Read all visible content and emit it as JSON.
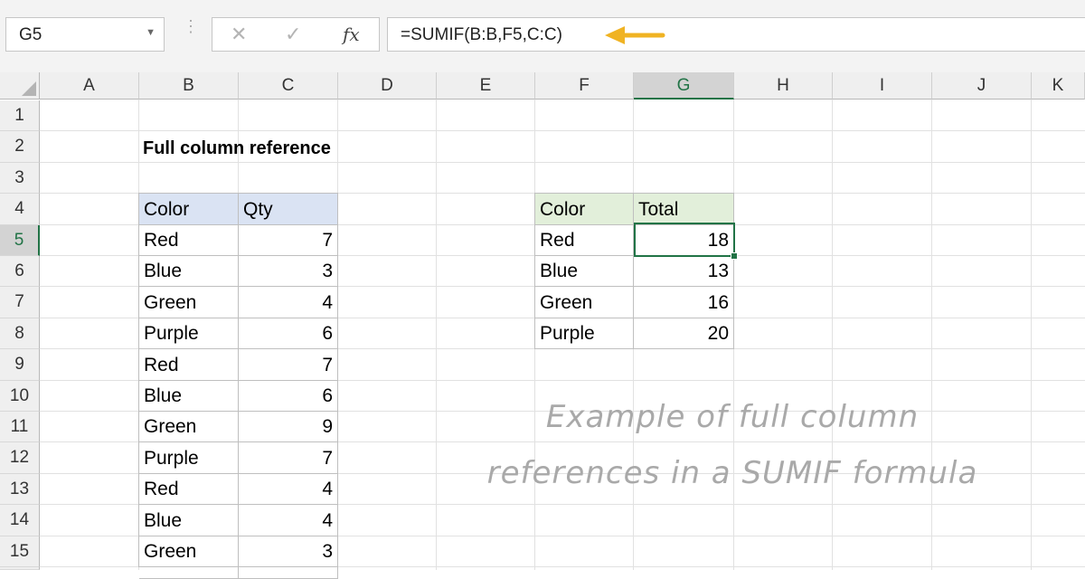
{
  "formula_bar": {
    "name_box": "G5",
    "formula": "=SUMIF(B:B,F5,C:C)",
    "cancel_icon": "x-icon",
    "enter_icon": "check-icon",
    "fx_label": "fx",
    "arrow_color": "#f0b323"
  },
  "columns": [
    "A",
    "B",
    "C",
    "D",
    "E",
    "F",
    "G",
    "H",
    "I",
    "J",
    "K"
  ],
  "selected_column": "G",
  "rows": [
    "1",
    "2",
    "3",
    "4",
    "5",
    "6",
    "7",
    "8",
    "9",
    "10",
    "11",
    "12",
    "13",
    "14",
    "15"
  ],
  "selected_row": "5",
  "sheet_title": "Full column reference",
  "data_table": {
    "headers": [
      "Color",
      "Qty"
    ],
    "rows": [
      [
        "Red",
        "7"
      ],
      [
        "Blue",
        "3"
      ],
      [
        "Green",
        "4"
      ],
      [
        "Purple",
        "6"
      ],
      [
        "Red",
        "7"
      ],
      [
        "Blue",
        "6"
      ],
      [
        "Green",
        "9"
      ],
      [
        "Purple",
        "7"
      ],
      [
        "Red",
        "4"
      ],
      [
        "Blue",
        "4"
      ],
      [
        "Green",
        "3"
      ]
    ]
  },
  "summary_table": {
    "headers": [
      "Color",
      "Total"
    ],
    "rows": [
      [
        "Red",
        "18"
      ],
      [
        "Blue",
        "13"
      ],
      [
        "Green",
        "16"
      ],
      [
        "Purple",
        "20"
      ]
    ]
  },
  "annotation": {
    "line1": "Example of full column",
    "line2": "references in a SUMIF formula"
  },
  "colors": {
    "accent_green": "#217346",
    "header_blue": "#dae3f3",
    "header_green": "#e2efda"
  }
}
